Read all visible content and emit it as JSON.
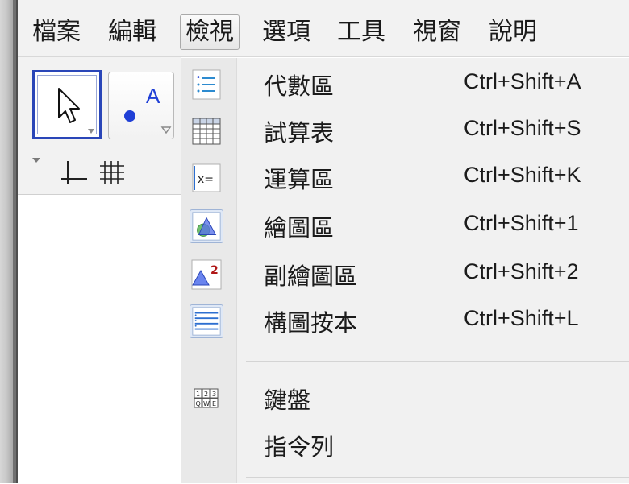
{
  "menubar": {
    "items": [
      "檔案",
      "編輯",
      "檢視",
      "選項",
      "工具",
      "視窗",
      "說明"
    ],
    "active_index": 2
  },
  "toolbar": {
    "tools": [
      {
        "icon": "cursor-arrow-icon",
        "selected": true
      },
      {
        "icon": "new-point-icon",
        "label": "A"
      }
    ],
    "view_controls": [
      "expand-triangle-icon",
      "axes-toggle-icon",
      "grid-toggle-icon"
    ]
  },
  "view_menu": {
    "items": [
      {
        "label": "代數區",
        "shortcut": "Ctrl+Shift+A",
        "icon": "algebra-view-icon",
        "checked": false
      },
      {
        "label": "試算表",
        "shortcut": "Ctrl+Shift+S",
        "icon": "spreadsheet-icon",
        "checked": false
      },
      {
        "label": "運算區",
        "shortcut": "Ctrl+Shift+K",
        "icon": "cas-view-icon",
        "checked": false
      },
      {
        "label": "繪圖區",
        "shortcut": "Ctrl+Shift+1",
        "icon": "graphics-view-icon",
        "checked": true
      },
      {
        "label": "副繪圖區",
        "shortcut": "Ctrl+Shift+2",
        "icon": "graphics-2-view-icon",
        "checked": false
      },
      {
        "label": "構圖按本",
        "shortcut": "Ctrl+Shift+L",
        "icon": "construction-protocol-icon",
        "checked": true
      },
      {
        "label": "鍵盤",
        "shortcut": "",
        "icon": "keyboard-icon",
        "checked": false
      },
      {
        "label": "指令列",
        "shortcut": "",
        "icon": "",
        "checked": false
      }
    ]
  },
  "colors": {
    "selected_border": "#2a46b8",
    "menu_bg": "#f1f1f1",
    "checked_icon_bg": "#dfe8f6",
    "point_blue": "#1f3fd6"
  }
}
